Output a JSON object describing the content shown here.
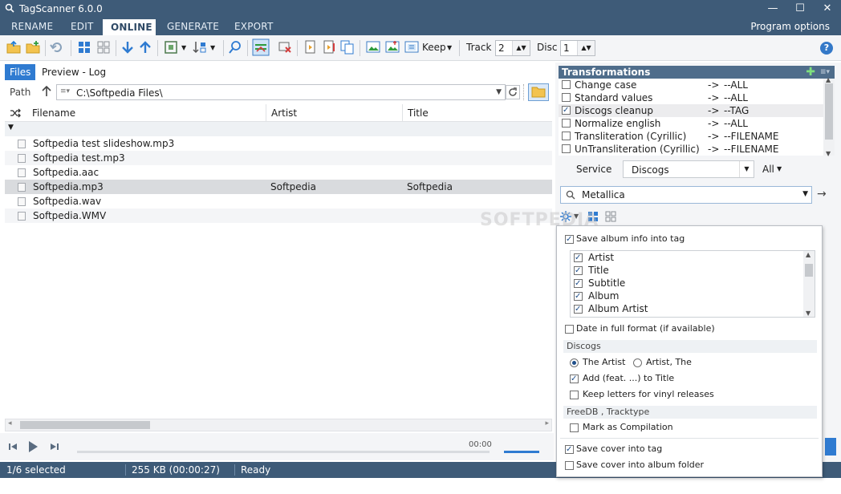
{
  "window": {
    "title": "TagScanner 6.0.0"
  },
  "menu": {
    "items": [
      "RENAME",
      "EDIT",
      "ONLINE",
      "GENERATE",
      "EXPORT"
    ],
    "active": "ONLINE",
    "program_options": "Program options"
  },
  "toolbar": {
    "keep_label": "Keep",
    "track_label": "Track",
    "track_value": "2",
    "disc_label": "Disc",
    "disc_value": "1"
  },
  "left": {
    "tabs": [
      "Files",
      "Preview - Log"
    ],
    "path_label": "Path",
    "path_value": "C:\\Softpedia Files\\",
    "columns": [
      "Filename",
      "Artist",
      "Title"
    ],
    "files": [
      {
        "filename": "Softpedia test slideshow.mp3",
        "artist": "",
        "title": ""
      },
      {
        "filename": "Softpedia test.mp3",
        "artist": "",
        "title": ""
      },
      {
        "filename": "Softpedia.aac",
        "artist": "",
        "title": ""
      },
      {
        "filename": "Softpedia.mp3",
        "artist": "Softpedia",
        "title": "Softpedia"
      },
      {
        "filename": "Softpedia.wav",
        "artist": "",
        "title": ""
      },
      {
        "filename": "Softpedia.WMV",
        "artist": "",
        "title": ""
      }
    ],
    "selected_index": 3
  },
  "player": {
    "time": "00:00"
  },
  "status": {
    "selected": "1/6 selected",
    "size": "255 KB (00:00:27)",
    "state": "Ready"
  },
  "transformations": {
    "title": "Transformations",
    "items": [
      {
        "name": "Change case",
        "target": "--ALL",
        "checked": false
      },
      {
        "name": "Standard values",
        "target": "--ALL",
        "checked": false
      },
      {
        "name": "Discogs cleanup",
        "target": "--TAG",
        "checked": true
      },
      {
        "name": "Normalize english",
        "target": "--ALL",
        "checked": false
      },
      {
        "name": "Transliteration (Cyrillic)",
        "target": "--FILENAME",
        "checked": false
      },
      {
        "name": "UnTransliteration (Cyrillic)",
        "target": "--FILENAME",
        "checked": false
      }
    ],
    "arrow": "->"
  },
  "service": {
    "label": "Service",
    "value": "Discogs",
    "filter": "All"
  },
  "search": {
    "value": "Metallica"
  },
  "popup": {
    "save_album_info": "Save album info into tag",
    "fields": [
      {
        "name": "Artist",
        "checked": true
      },
      {
        "name": "Title",
        "checked": true
      },
      {
        "name": "Subtitle",
        "checked": true
      },
      {
        "name": "Album",
        "checked": true
      },
      {
        "name": "Album Artist",
        "checked": true
      }
    ],
    "date_full": "Date in full format (if available)",
    "discogs_header": "Discogs",
    "radio_the_artist": "The Artist",
    "radio_artist_the": "Artist, The",
    "add_feat": "Add (feat. ...) to Title",
    "keep_letters": "Keep letters for vinyl releases",
    "freedb_header": "FreeDB , Tracktype",
    "mark_compilation": "Mark as Compilation",
    "save_cover": "Save cover into tag",
    "save_cover_folder": "Save cover into album folder"
  },
  "watermark": "SOFTPEDIA"
}
